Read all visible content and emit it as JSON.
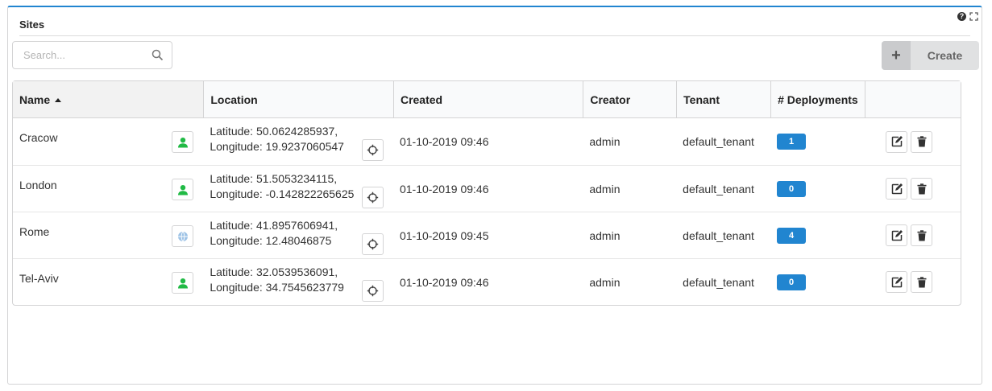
{
  "widget": {
    "title": "Sites"
  },
  "search": {
    "placeholder": "Search...",
    "value": ""
  },
  "toolbar": {
    "create_label": "Create",
    "create_icon": "+"
  },
  "table": {
    "columns": [
      "Name",
      "Location",
      "Created",
      "Creator",
      "Tenant",
      "# Deployments",
      ""
    ],
    "sorted_column": "Name",
    "sort_direction": "ascending",
    "rows": [
      {
        "name": "Cracow",
        "type_icon": "user-icon",
        "latitude": "Latitude: 50.0624285937,",
        "longitude": "Longitude: 19.9237060547",
        "created": "01-10-2019 09:46",
        "creator": "admin",
        "tenant": "default_tenant",
        "deployments": "1"
      },
      {
        "name": "London",
        "type_icon": "user-icon",
        "latitude": "Latitude: 51.5053234115,",
        "longitude": "Longitude: -0.142822265625",
        "created": "01-10-2019 09:46",
        "creator": "admin",
        "tenant": "default_tenant",
        "deployments": "0"
      },
      {
        "name": "Rome",
        "type_icon": "globe-icon",
        "latitude": "Latitude: 41.8957606941,",
        "longitude": "Longitude: 12.48046875",
        "created": "01-10-2019 09:45",
        "creator": "admin",
        "tenant": "default_tenant",
        "deployments": "4"
      },
      {
        "name": "Tel-Aviv",
        "type_icon": "user-icon",
        "latitude": "Latitude: 32.0539536091,",
        "longitude": "Longitude: 34.7545623779",
        "created": "01-10-2019 09:46",
        "creator": "admin",
        "tenant": "default_tenant",
        "deployments": "0"
      }
    ]
  },
  "colors": {
    "accent": "#2185d0",
    "visibility_green": "#21ba45",
    "globe_blue": "#9ec3e6"
  }
}
